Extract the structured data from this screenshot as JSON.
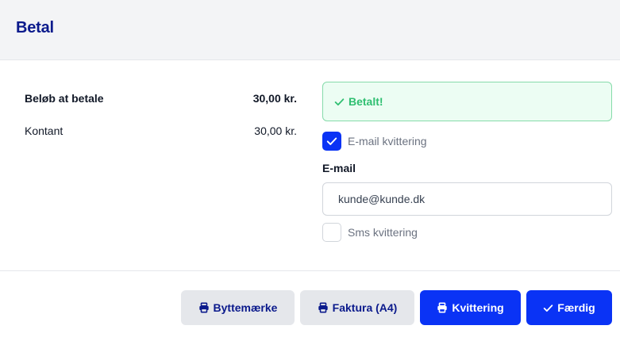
{
  "header": {
    "title": "Betal"
  },
  "summary": {
    "total_label": "Beløb at betale",
    "total_value": "30,00 kr.",
    "cash_label": "Kontant",
    "cash_value": "30,00 kr."
  },
  "status": {
    "message": "Betalt!",
    "color": "#2fbf71"
  },
  "email_receipt": {
    "label": "E-mail kvittering",
    "checked": true
  },
  "email": {
    "label": "E-mail",
    "value": "kunde@kunde.dk"
  },
  "sms_receipt": {
    "label": "Sms kvittering",
    "checked": false
  },
  "actions": {
    "exchange_label": "Byttemærke",
    "invoice_label": "Faktura (A4)",
    "receipt_label": "Kvittering",
    "done_label": "Færdig"
  },
  "colors": {
    "primary": "#0a33f5",
    "brand_text": "#0b1a8c",
    "success_bg": "#ecfdf3"
  },
  "icons": {
    "print": "printer-icon",
    "check": "check-icon"
  }
}
